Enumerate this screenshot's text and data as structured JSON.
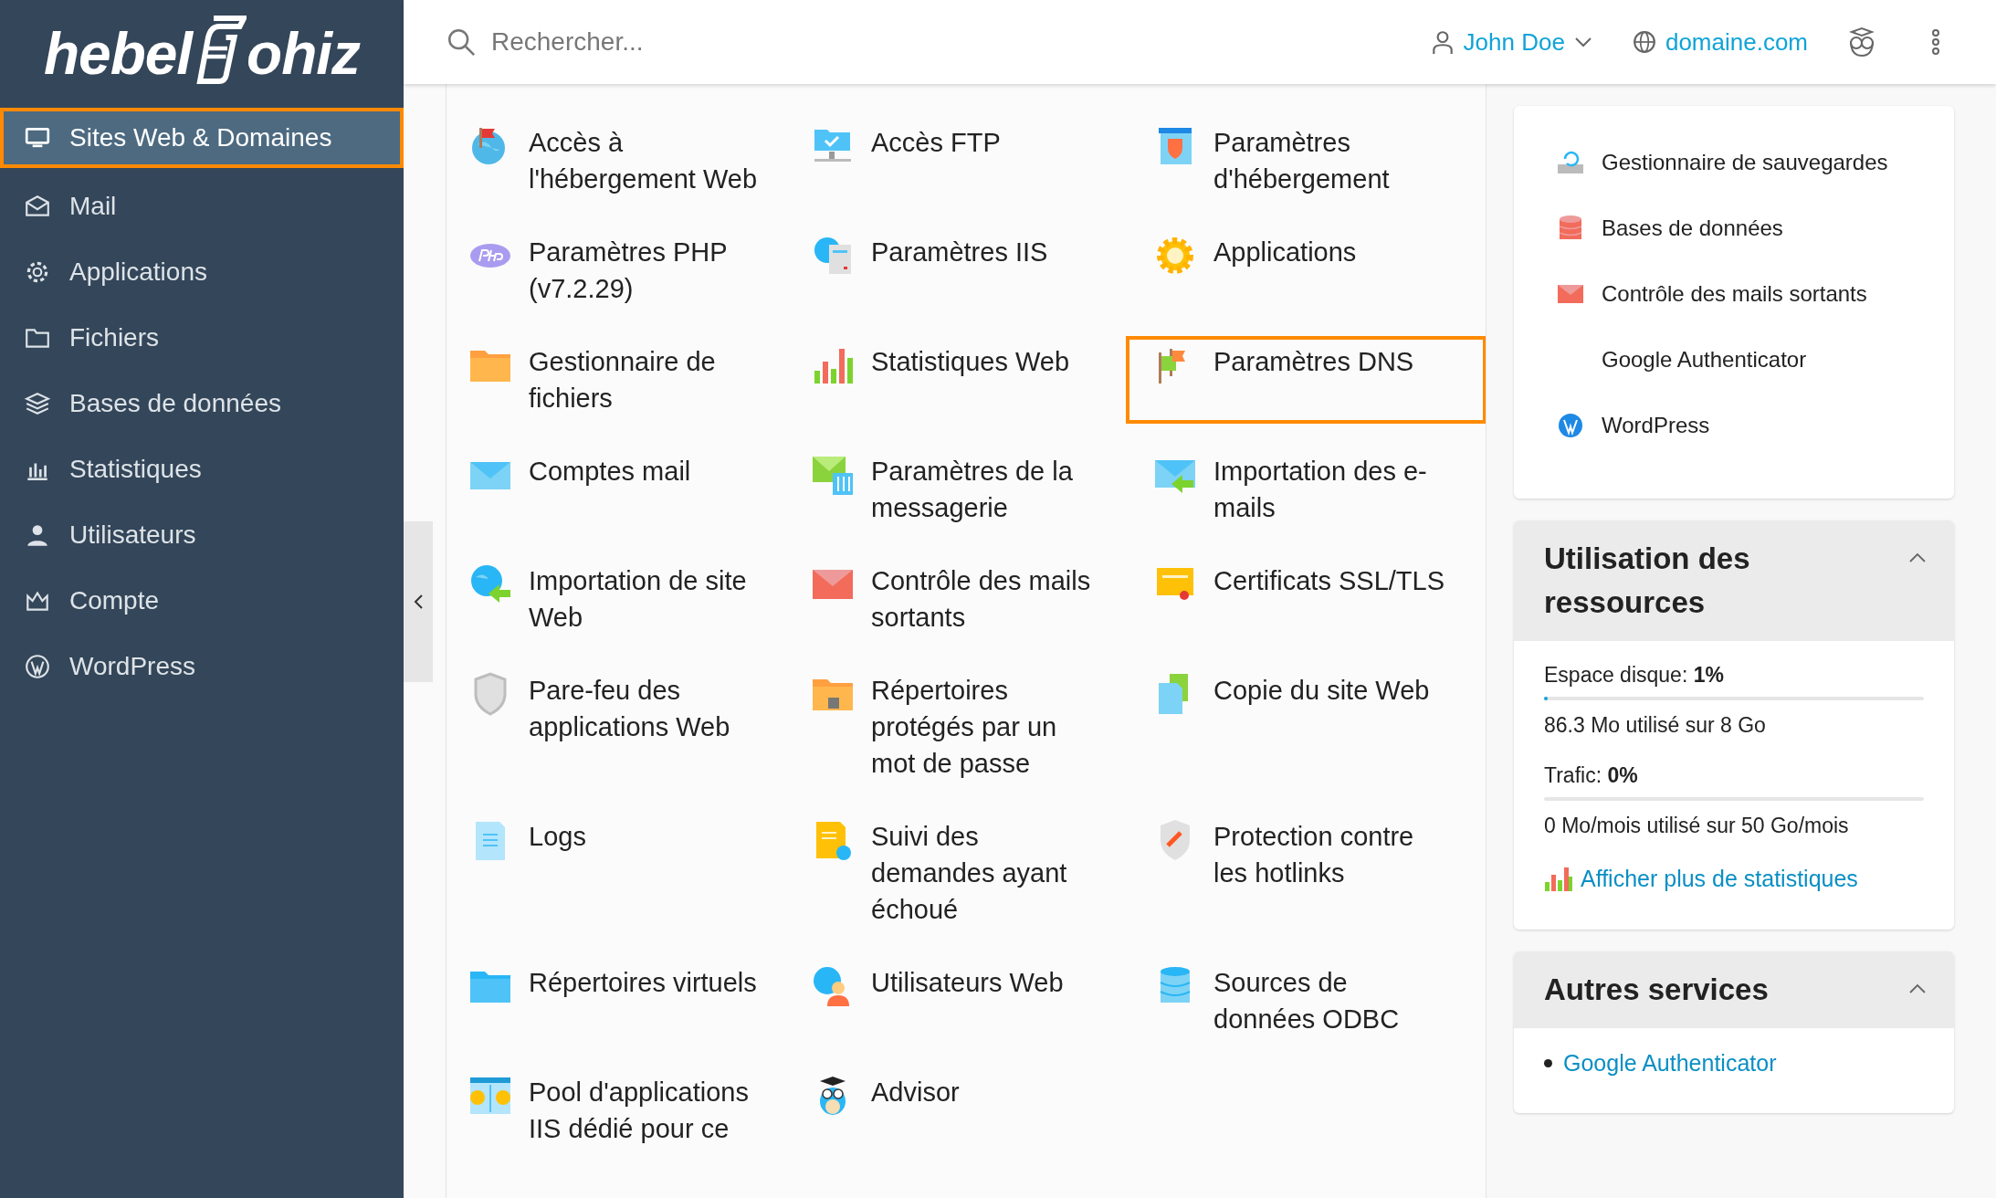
{
  "logo": {
    "left": "hebel",
    "right": "ohiz"
  },
  "sidebar": {
    "items": [
      {
        "label": "Sites Web & Domaines",
        "selected": true,
        "highlighted": true
      },
      {
        "label": "Mail",
        "selected": false,
        "highlighted": false
      },
      {
        "label": "Applications",
        "selected": false,
        "highlighted": false
      },
      {
        "label": "Fichiers",
        "selected": false,
        "highlighted": false
      },
      {
        "label": "Bases de données",
        "selected": false,
        "highlighted": false
      },
      {
        "label": "Statistiques",
        "selected": false,
        "highlighted": false
      },
      {
        "label": "Utilisateurs",
        "selected": false,
        "highlighted": false
      },
      {
        "label": "Compte",
        "selected": false,
        "highlighted": false
      },
      {
        "label": "WordPress",
        "selected": false,
        "highlighted": false
      }
    ]
  },
  "topbar": {
    "search": {
      "placeholder": "Rechercher..."
    },
    "user": "John Doe",
    "domain": "domaine.com"
  },
  "tools": [
    {
      "label": "Accès à l'hébergement Web",
      "highlighted": false
    },
    {
      "label": "Accès FTP",
      "highlighted": false
    },
    {
      "label": "Paramètres d'hébergement",
      "highlighted": false
    },
    {
      "label": "Paramètres PHP (v7.2.29)",
      "highlighted": false
    },
    {
      "label": "Paramètres IIS",
      "highlighted": false
    },
    {
      "label": "Applications",
      "highlighted": false
    },
    {
      "label": "Gestionnaire de fichiers",
      "highlighted": false
    },
    {
      "label": "Statistiques Web",
      "highlighted": false
    },
    {
      "label": "Paramètres DNS",
      "highlighted": true
    },
    {
      "label": "Comptes mail",
      "highlighted": false
    },
    {
      "label": "Paramètres de la messagerie",
      "highlighted": false
    },
    {
      "label": "Importation des e-mails",
      "highlighted": false
    },
    {
      "label": "Importation de site Web",
      "highlighted": false
    },
    {
      "label": "Contrôle des mails sortants",
      "highlighted": false
    },
    {
      "label": "Certificats SSL/TLS",
      "highlighted": false
    },
    {
      "label": "Pare-feu des applications Web",
      "highlighted": false
    },
    {
      "label": "Répertoires protégés par un mot de passe",
      "highlighted": false
    },
    {
      "label": "Copie du site Web",
      "highlighted": false
    },
    {
      "label": "Logs",
      "highlighted": false
    },
    {
      "label": "Suivi des demandes ayant échoué",
      "highlighted": false
    },
    {
      "label": "Protection contre les hotlinks",
      "highlighted": false
    },
    {
      "label": "Répertoires virtuels",
      "highlighted": false
    },
    {
      "label": "Utilisateurs Web",
      "highlighted": false
    },
    {
      "label": "Sources de données ODBC",
      "highlighted": false
    },
    {
      "label": "Pool d'applications IIS dédié pour ce",
      "highlighted": false
    },
    {
      "label": "Advisor",
      "highlighted": false
    }
  ],
  "quick_links": [
    {
      "label": "Gestionnaire de sauvegardes",
      "kind": "backup"
    },
    {
      "label": "Bases de données",
      "kind": "database"
    },
    {
      "label": "Contrôle des mails sortants",
      "kind": "mail"
    },
    {
      "label": "Google Authenticator",
      "kind": "plain"
    },
    {
      "label": "WordPress",
      "kind": "wordpress"
    }
  ],
  "resources": {
    "title": "Utilisation des ressources",
    "expanded": true,
    "meters": [
      {
        "label": "Espace disque: **1%**",
        "level": 0.01,
        "detail": "86.3 Mo utilisé sur 8 Go"
      },
      {
        "label": "Trafic: **0%**",
        "level": 0,
        "detail": "0 Mo/mois utilisé sur 50 Go/mois"
      }
    ],
    "link": "Afficher plus de statistiques"
  },
  "services": {
    "title": "Autres services",
    "expanded": true,
    "items": [
      "Google Authenticator"
    ]
  }
}
